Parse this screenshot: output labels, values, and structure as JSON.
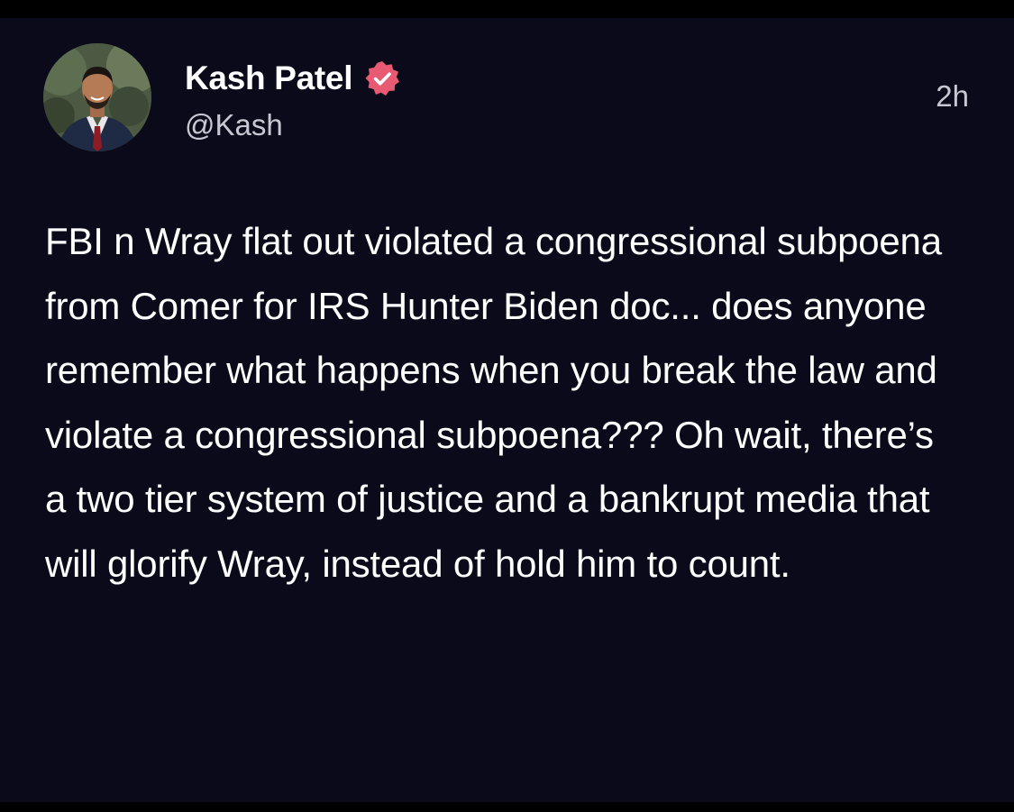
{
  "post": {
    "author": {
      "display_name": "Kash Patel",
      "handle": "@Kash",
      "avatar_icon": "profile-photo",
      "verified_icon": "verified-badge-icon"
    },
    "timestamp": "2h",
    "text": "FBI n Wray flat out violated a congressional subpoena from Comer for IRS Hunter Biden doc... does anyone remember what happens when you break the law and violate a congressional subpoena??? Oh wait, there’s a two tier system of justice and a bankrupt media that will glorify Wray, instead of hold him to count."
  },
  "colors": {
    "background": "#0b0a1a",
    "text_primary": "#ffffff",
    "text_secondary": "#c9c8d2",
    "verified_badge": "#e85a71"
  }
}
